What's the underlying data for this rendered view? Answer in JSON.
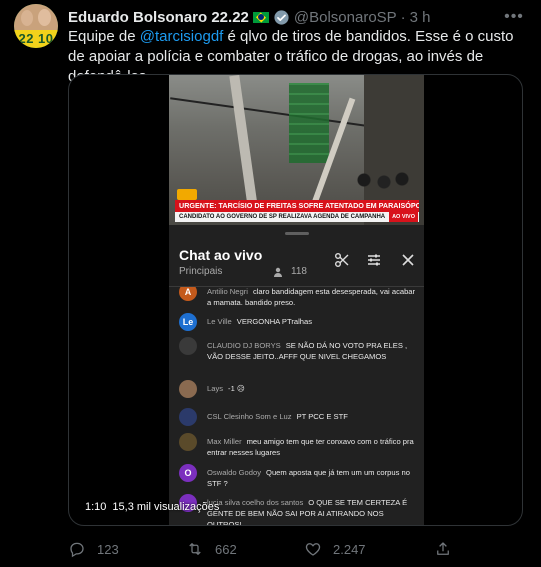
{
  "author": {
    "name": "Eduardo Bolsonaro 22.22",
    "handle": "@BolsonaroSP",
    "time": "3 h",
    "avatar_number": "22 10"
  },
  "tweet": {
    "text_before": "Equipe de ",
    "mention": "@tarcisiogdf",
    "text_after": " é qlvo de tiros de bandidos. Esse é o custo de apoiar a polícia e combater o tráfico de drogas, ao invés de defendê-los."
  },
  "video": {
    "urgent_banner": "URGENTE: TARCÍSIO DE FREITAS SOFRE ATENTADO EM PARAISÓPOLIS",
    "sub_banner": "CANDIDATO AO GOVERNO DE SP REALIZAVA AGENDA DE CAMPANHA",
    "live_tag": "AO VIVO",
    "duration": "1:10",
    "views": "15,3 mil visualizações"
  },
  "chat": {
    "title": "Chat ao vivo",
    "subtitle": "Principais",
    "viewers": "118",
    "messages": [
      {
        "author": "Antilio Negri",
        "text": "claro bandidagem esta desesperada, vai acabar a mamata. bandido preso.",
        "initial": "A",
        "color": "#c45a1c"
      },
      {
        "author": "Le Ville",
        "text": "VERGONHA PTralhas",
        "initial": "Le",
        "color": "#1e6fd0"
      },
      {
        "author": "CLAUDIO DJ BORYS",
        "text": "SE NÃO DÁ NO VOTO PRA ELES , VÃO DESSE JEITO..AFFF QUE NIVEL CHEGAMOS",
        "initial": "",
        "color": "#3a3a3a"
      },
      {
        "author": "Lays",
        "text": "-1 😥",
        "initial": "",
        "color": "#8a6a50"
      },
      {
        "author": "CSL Clesinho Som e Luz",
        "text": "PT PCC E STF",
        "initial": "",
        "color": "#2b3a6a"
      },
      {
        "author": "Max Miller",
        "text": "meu amigo tem que ter conxavo com o tráfico pra entrar nesses lugares",
        "initial": "",
        "color": "#5a4a2a"
      },
      {
        "author": "Oswaldo Godoy",
        "text": "Quem aposta que já tem um um corpus no STF ?",
        "initial": "O",
        "color": "#7b2fbe"
      },
      {
        "author": "lucia silva coelho dos santos",
        "text": "O QUE SE TEM CERTEZA É GENTE DE BEM NÃO SAI POR AI ATIRANDO NOS OUTROS!",
        "initial": "",
        "color": "#7b2fbe"
      }
    ]
  },
  "actions": {
    "replies": "123",
    "retweets": "662",
    "likes": "2.247"
  },
  "colors": {
    "accent": "#1d9bf0",
    "muted": "#71767b",
    "urgent_red": "#d8121b"
  }
}
